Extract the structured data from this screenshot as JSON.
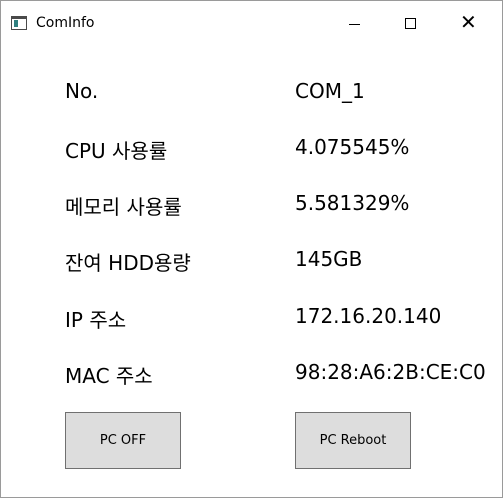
{
  "window": {
    "title": "ComInfo",
    "icon": "app-window-icon",
    "controls": {
      "minimize": "minimize-icon",
      "maximize": "maximize-icon",
      "close": "close-icon",
      "close_glyph": "✕"
    }
  },
  "info": [
    {
      "label": "No.",
      "value": "COM_1"
    },
    {
      "label": "CPU 사용률",
      "value": "4.075545%"
    },
    {
      "label": "메모리 사용률",
      "value": "5.581329%"
    },
    {
      "label": "잔여 HDD용량",
      "value": "145GB"
    },
    {
      "label": "IP 주소",
      "value": "172.16.20.140"
    },
    {
      "label": "MAC 주소",
      "value": "98:28:A6:2B:CE:C0"
    }
  ],
  "buttons": {
    "pc_off": "PC OFF",
    "pc_reboot": "PC Reboot"
  }
}
